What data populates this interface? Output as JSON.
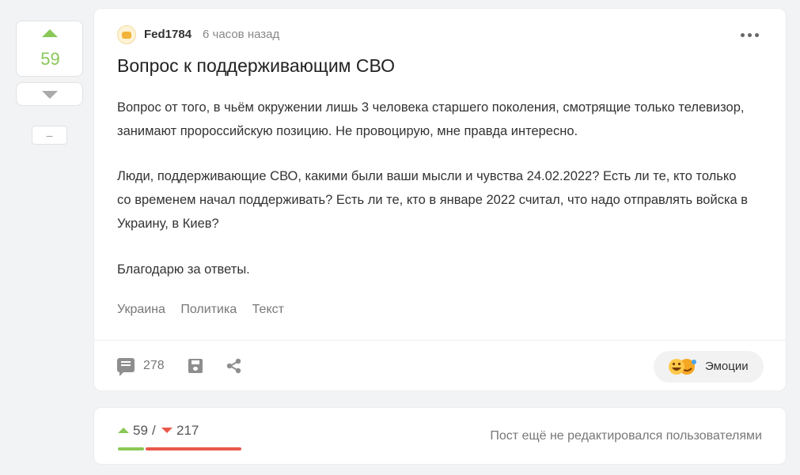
{
  "vote": {
    "count": "59"
  },
  "collapse": {
    "label": "–"
  },
  "post": {
    "author": "Fed1784",
    "time": "6 часов назад",
    "title": "Вопрос к поддерживающим СВО",
    "paragraphs": [
      "Вопрос от того, в чьём окружении лишь 3 человека старшего поколения, смотрящие только телевизор, занимают пророссийскую позицию. Не провоцирую, мне правда интересно.",
      "Люди, поддерживающие СВО, какими были ваши мысли и чувства 24.02.2022? Есть ли те, кто только со временем начал поддерживать? Есть ли те, кто в январе 2022 считал, что надо отправлять войска в Украину, в Киев?",
      "Благодарю за ответы."
    ],
    "tags": [
      "Украина",
      "Политика",
      "Текст"
    ]
  },
  "actions": {
    "comment_count": "278",
    "emotions_label": "Эмоции"
  },
  "rating": {
    "plus": "59",
    "separator": "/",
    "minus": "217",
    "plus_value": 59,
    "minus_value": 217,
    "note": "Пост ещё не редактировался пользователями"
  },
  "colors": {
    "upvote": "#8ac858",
    "downvote": "#e8594a",
    "background": "#f2f3f5"
  },
  "icons": [
    "arrow-up-icon",
    "arrow-down-icon",
    "more-icon",
    "comment-icon",
    "save-icon",
    "share-icon",
    "emotions-icon"
  ]
}
